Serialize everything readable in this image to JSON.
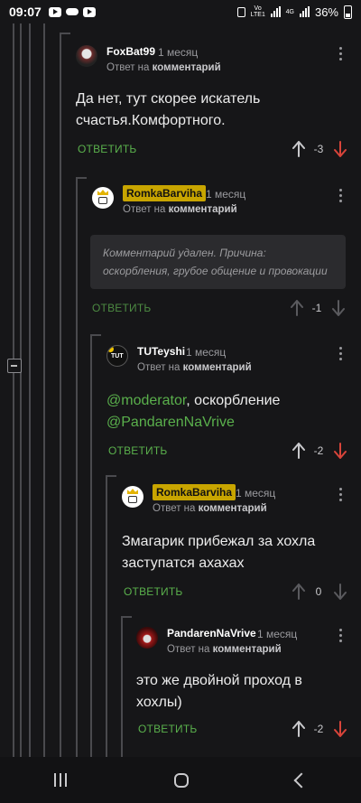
{
  "status": {
    "time": "09:07",
    "network": "Vo LTE1",
    "network_type": "4G",
    "battery": "36%"
  },
  "comments": [
    {
      "author": "FoxBat99",
      "date": "1 месяц",
      "reply_prefix": "Ответ на",
      "reply_target": "комментарий",
      "text_lines": [
        "Да нет, тут скорее искатель",
        "счастья.Комфортного."
      ],
      "answer": "ОТВЕТИТЬ",
      "score": "-3"
    },
    {
      "author": "RomkaBarviha",
      "date": "1 месяц",
      "reply_prefix": "Ответ на",
      "reply_target": "комментарий",
      "deleted_text": "Комментарий удален. Причина: оскорбления, грубое общение и провокации",
      "answer": "ОТВЕТИТЬ",
      "score": "-1"
    },
    {
      "author": "TUTeyshi",
      "date": "1 месяц",
      "reply_prefix": "Ответ на",
      "reply_target": "комментарий",
      "mention1": "@moderator",
      "text_mid": ", оскорбление",
      "mention2": "@PandarenNaVrive",
      "answer": "ОТВЕТИТЬ",
      "score": "-2"
    },
    {
      "author": "RomkaBarviha",
      "date": "1 месяц",
      "reply_prefix": "Ответ на",
      "reply_target": "комментарий",
      "text_lines": [
        "Змагарик прибежал за хохла",
        "заступатся ахахах"
      ],
      "answer": "ОТВЕТИТЬ",
      "score": "0"
    },
    {
      "author": "PandarenNaVrive",
      "date": "1 месяц",
      "reply_prefix": "Ответ на",
      "reply_target": "комментарий",
      "text_lines": [
        "это же двойной проход в",
        "хохлы)"
      ],
      "answer": "ОТВЕТИТЬ",
      "score": "-2"
    }
  ],
  "colors": {
    "accent_green": "#5ab04c",
    "downvote_red": "#d8443a",
    "badge_gold": "#c8a500"
  }
}
